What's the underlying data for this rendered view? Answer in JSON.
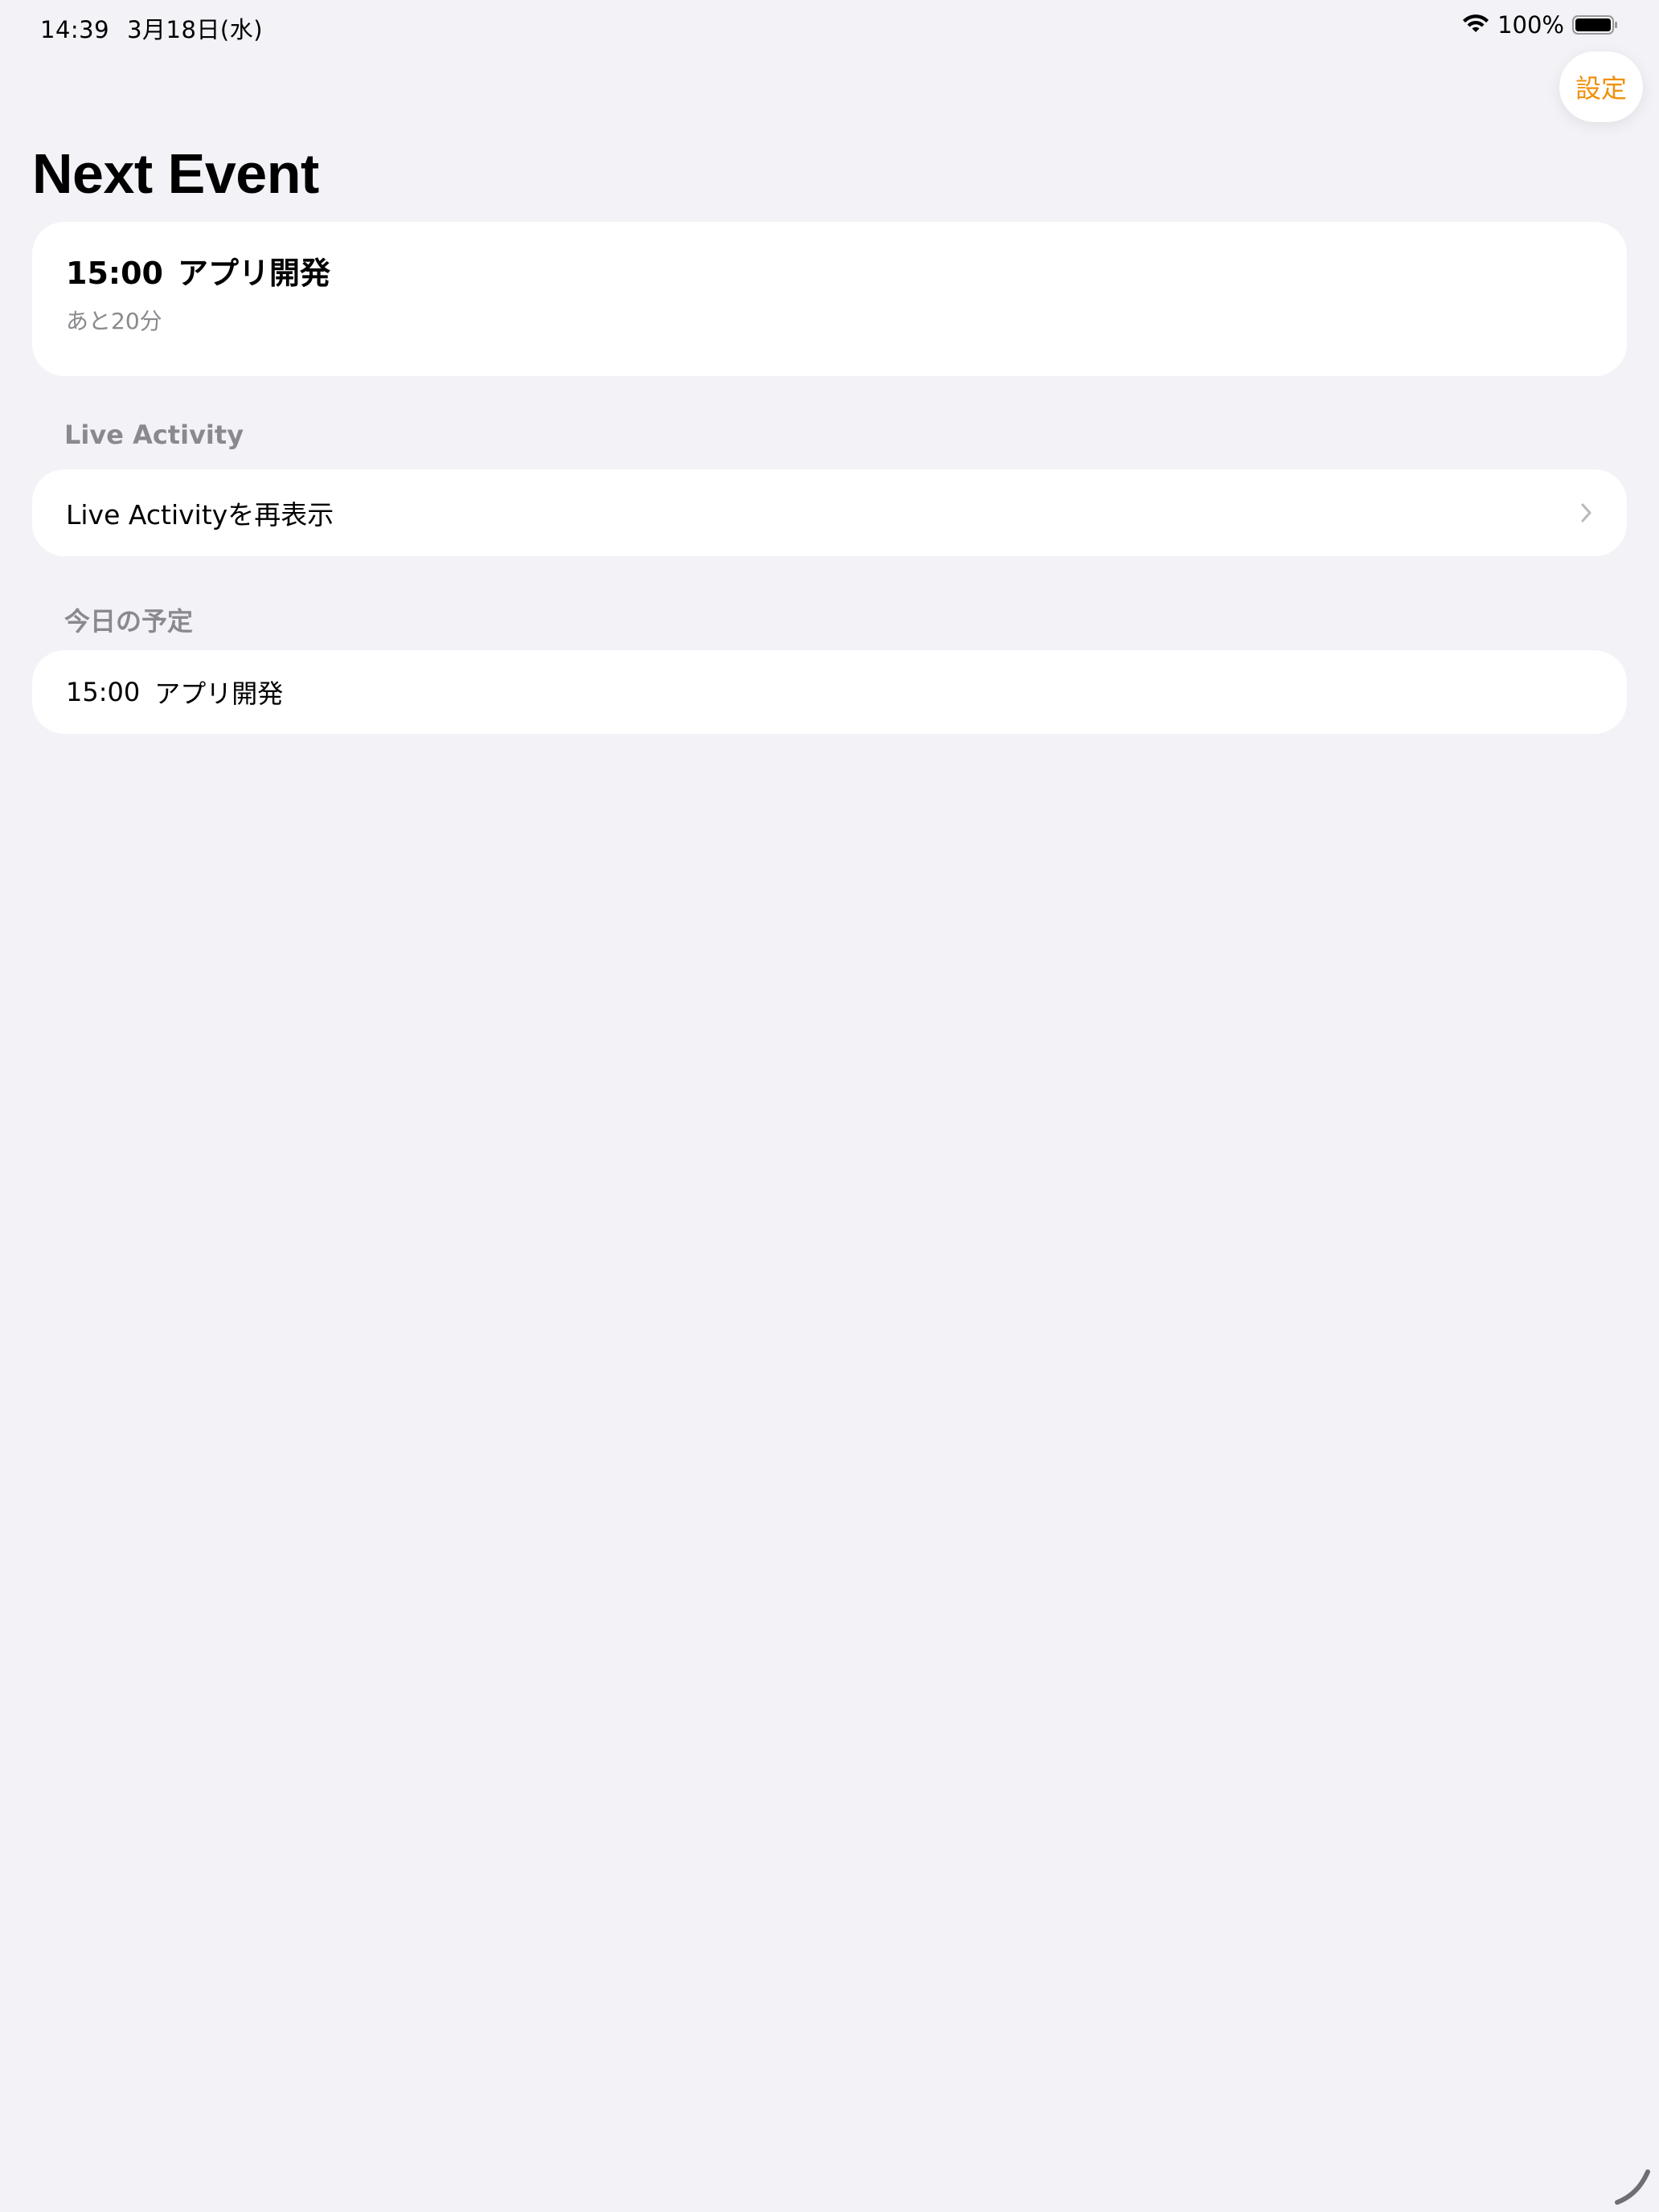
{
  "status_bar": {
    "time": "14:39",
    "date": "3月18日(水)",
    "battery": "100%",
    "wifi_icon": "wifi-icon",
    "battery_icon": "battery-icon"
  },
  "toolbar": {
    "settings_label": "設定",
    "accent_color": "#f0900a"
  },
  "page": {
    "title": "Next Event"
  },
  "next_event": {
    "time": "15:00",
    "title": "アプリ開発",
    "remaining": "あと20分"
  },
  "live_activity": {
    "header": "Live Activity",
    "row_label": "Live Activityを再表示",
    "chevron_icon": "chevron-right-icon"
  },
  "today": {
    "header": "今日の予定",
    "events": [
      {
        "time": "15:00",
        "title": "アプリ開発"
      }
    ]
  },
  "colors": {
    "background": "#f2f2f7",
    "card": "#ffffff",
    "secondary_text": "#8a8a8e"
  }
}
